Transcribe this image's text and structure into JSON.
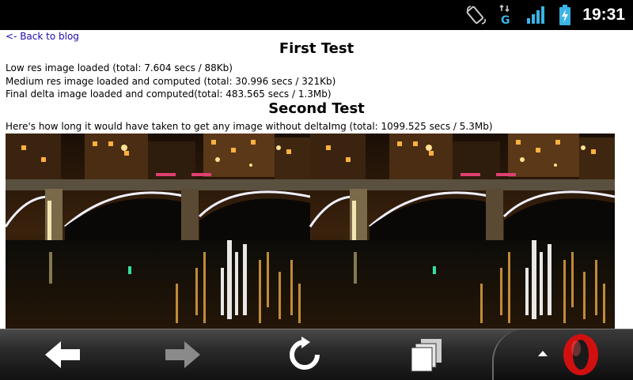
{
  "status_bar": {
    "time": "19:31",
    "icons": [
      "screen-rotation-icon",
      "network-g-icon",
      "signal-strength-icon",
      "battery-charging-icon"
    ],
    "network_type": "G"
  },
  "page": {
    "back_link": "<- Back to blog",
    "first_test": {
      "heading": "First Test",
      "lines": [
        "Low res image loaded (total: 7.604 secs / 88Kb)",
        "Medium res image loaded and computed (total: 30.996 secs / 321Kb)",
        "Final delta image loaded and computed(total: 483.565 secs / 1.3Mb)"
      ]
    },
    "second_test": {
      "heading": "Second Test",
      "line": "Here's how long it would have taken to get any image without deltaImg (total: 1099.525 secs / 5.3Mb)"
    }
  },
  "toolbar": {
    "buttons": [
      "back-arrow-icon",
      "forward-arrow-icon",
      "reload-icon",
      "tabs-icon",
      "opera-menu-icon"
    ]
  }
}
